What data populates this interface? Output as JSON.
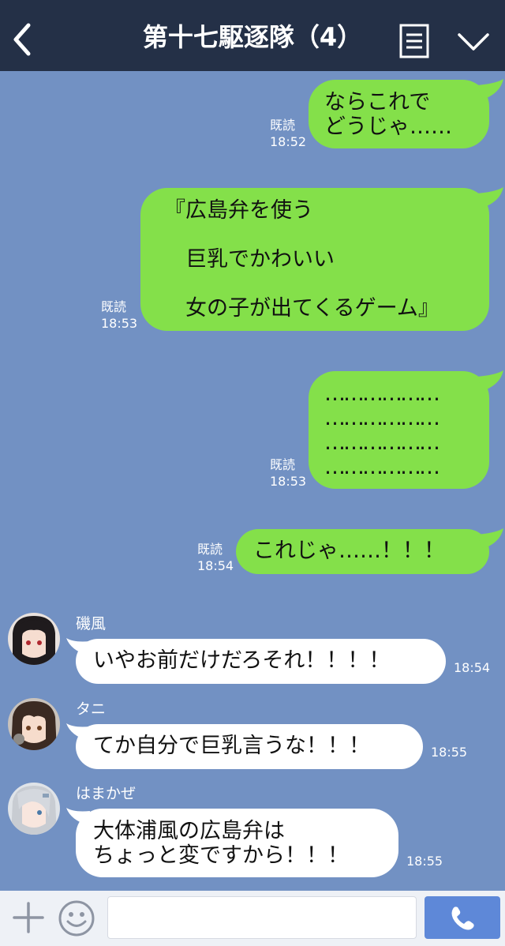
{
  "header": {
    "title": "第十七駆逐隊（4）"
  },
  "read_label": "既読",
  "sent_messages": [
    {
      "lines": [
        "ならこれで",
        "どうじゃ……"
      ],
      "time": "18:52"
    },
    {
      "lines": [
        "『広島弁を使う",
        "",
        "　巨乳でかわいい",
        "",
        "　女の子が出てくるゲーム』"
      ],
      "time": "18:53"
    },
    {
      "lines": [
        "………………",
        "………………",
        "………………",
        "………………"
      ],
      "time": "18:53"
    },
    {
      "lines": [
        "これじゃ……！！！"
      ],
      "time": "18:54"
    }
  ],
  "received_messages": [
    {
      "sender": "磯風",
      "lines": [
        "いやお前だけだろそれ！！！！"
      ],
      "time": "18:54"
    },
    {
      "sender": "タニ",
      "lines": [
        "てか自分で巨乳言うな！！！"
      ],
      "time": "18:55"
    },
    {
      "sender": "はまかぜ",
      "lines": [
        "大体浦風の広島弁は",
        "ちょっと変ですから！！！"
      ],
      "time": "18:55"
    }
  ],
  "colors": {
    "background": "#7291c3",
    "header": "#243047",
    "sent_bubble": "#84e04a",
    "received_bubble": "#ffffff",
    "call_button": "#5e88d8"
  },
  "icons": {
    "back": "back-chevron-icon",
    "menu": "menu-list-icon",
    "collapse": "chevron-down-icon",
    "add": "plus-icon",
    "emoji": "emoji-icon",
    "call": "phone-icon"
  }
}
